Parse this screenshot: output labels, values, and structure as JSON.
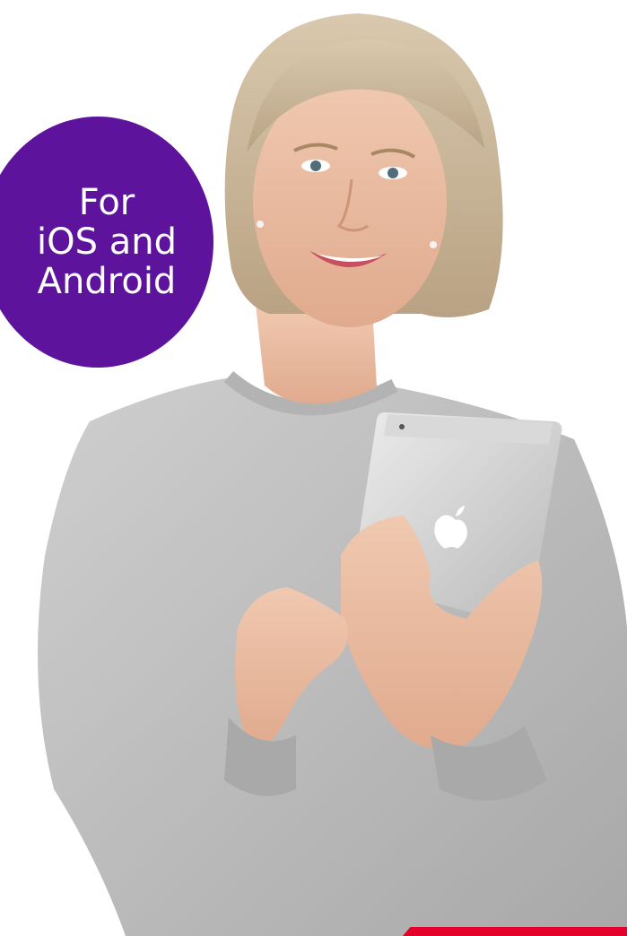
{
  "badge": {
    "line1": "For",
    "line2": "iOS and",
    "line3": "Android"
  },
  "colors": {
    "badge": "#5e139c",
    "badge_text": "#ffffff",
    "accent": "#e4002b",
    "background": "#ffffff"
  },
  "image": {
    "subject": "woman-holding-tablet"
  }
}
